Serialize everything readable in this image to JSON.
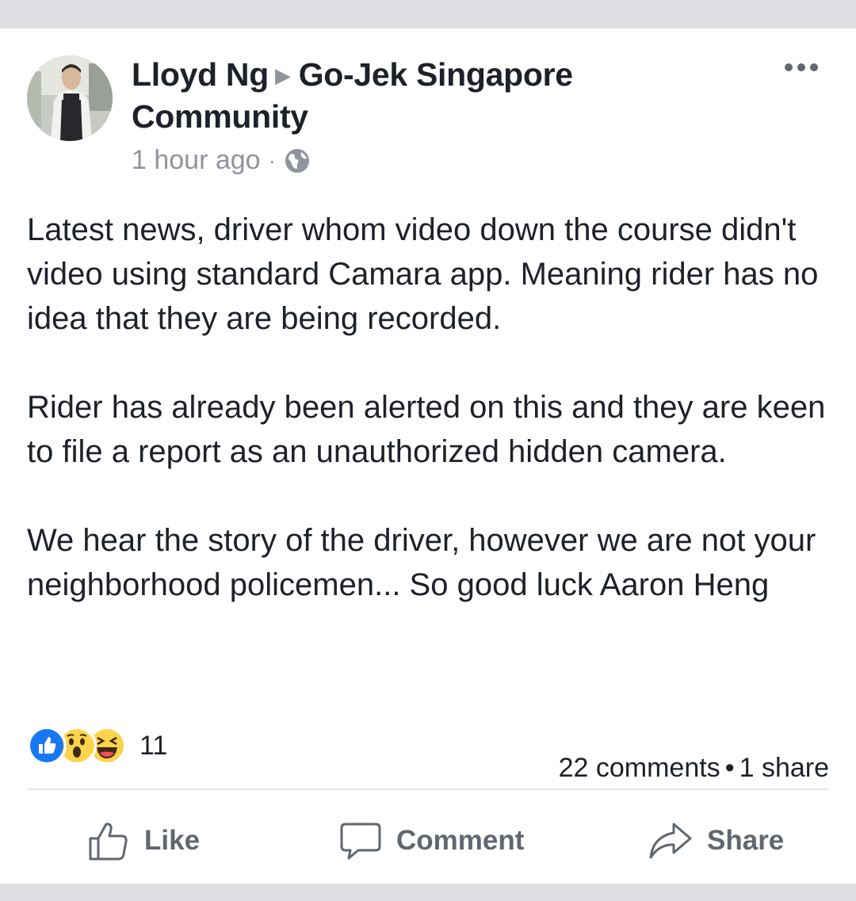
{
  "post": {
    "author": "Lloyd Ng",
    "group": "Go-Jek Singapore Community",
    "time": "1 hour ago",
    "meta_separator": "·",
    "privacy_icon": "globe-icon",
    "more_icon": "more-options-icon",
    "paragraphs": [
      "Latest news, driver whom video down the course didn't video using standard Camara app. Meaning rider has no idea that they are being recorded.",
      "Rider has already been alerted on this and they are keen to file a report as an unauthorized hidden camera.",
      "We hear the story of the driver, however we are not your neighborhood policemen... So good luck Aaron Heng"
    ]
  },
  "reactions": {
    "icons": [
      "like-reaction-icon",
      "wow-reaction-icon",
      "haha-reaction-icon"
    ],
    "count": "11"
  },
  "stats": {
    "comments": "22 comments",
    "separator": "•",
    "shares": "1 share"
  },
  "actions": {
    "like_label": "Like",
    "comment_label": "Comment",
    "share_label": "Share"
  },
  "colors": {
    "like_blue": "#1877f2",
    "emoji_yellow": "#fcd34a",
    "secondary_text": "#90949c",
    "action_grey": "#606770",
    "page_background": "#dddfe2"
  }
}
